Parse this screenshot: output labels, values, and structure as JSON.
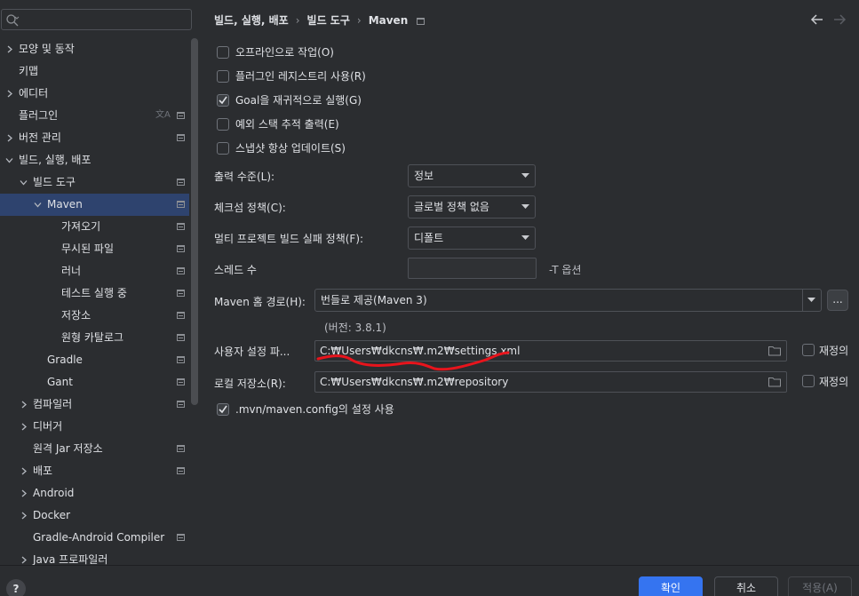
{
  "sidebar": {
    "search_placeholder": "",
    "items": [
      {
        "label": "모양 및 동작",
        "level": 0,
        "chevron": "right",
        "pin": false
      },
      {
        "label": "키맵",
        "level": 0,
        "chevron": "none",
        "pin": false
      },
      {
        "label": "에디터",
        "level": 0,
        "chevron": "right",
        "pin": false
      },
      {
        "label": "플러그인",
        "level": 0,
        "chevron": "none",
        "pin": true,
        "translate": true
      },
      {
        "label": "버전 관리",
        "level": 0,
        "chevron": "right",
        "pin": true
      },
      {
        "label": "빌드, 실행, 배포",
        "level": 0,
        "chevron": "down",
        "pin": false
      },
      {
        "label": "빌드 도구",
        "level": 1,
        "chevron": "down",
        "pin": true
      },
      {
        "label": "Maven",
        "level": 2,
        "chevron": "down",
        "pin": true,
        "selected": true
      },
      {
        "label": "가져오기",
        "level": 3,
        "chevron": "none",
        "pin": true
      },
      {
        "label": "무시된 파일",
        "level": 3,
        "chevron": "none",
        "pin": true
      },
      {
        "label": "러너",
        "level": 3,
        "chevron": "none",
        "pin": true
      },
      {
        "label": "테스트 실행 중",
        "level": 3,
        "chevron": "none",
        "pin": true
      },
      {
        "label": "저장소",
        "level": 3,
        "chevron": "none",
        "pin": true
      },
      {
        "label": "원형 카탈로그",
        "level": 3,
        "chevron": "none",
        "pin": true
      },
      {
        "label": "Gradle",
        "level": 2,
        "chevron": "none",
        "pin": true
      },
      {
        "label": "Gant",
        "level": 2,
        "chevron": "none",
        "pin": true
      },
      {
        "label": "컴파일러",
        "level": 1,
        "chevron": "right",
        "pin": true
      },
      {
        "label": "디버거",
        "level": 1,
        "chevron": "right",
        "pin": false
      },
      {
        "label": "원격 Jar 저장소",
        "level": 1,
        "chevron": "none",
        "pin": true
      },
      {
        "label": "배포",
        "level": 1,
        "chevron": "right",
        "pin": true
      },
      {
        "label": "Android",
        "level": 1,
        "chevron": "right",
        "pin": false
      },
      {
        "label": "Docker",
        "level": 1,
        "chevron": "right",
        "pin": false
      },
      {
        "label": "Gradle-Android Compiler",
        "level": 1,
        "chevron": "none",
        "pin": true
      },
      {
        "label": "Java 프로파일러",
        "level": 1,
        "chevron": "right",
        "pin": false
      }
    ]
  },
  "header": {
    "crumbs": [
      "빌드, 실행, 배포",
      "빌드 도구",
      "Maven"
    ]
  },
  "options": {
    "offline": {
      "label": "오프라인으로 작업(O)",
      "checked": false
    },
    "plugin_registry": {
      "label": "플러그인 레지스트리 사용(R)",
      "checked": false
    },
    "recursive_goals": {
      "label": "Goal을 재귀적으로 실행(G)",
      "checked": true
    },
    "stack_traces": {
      "label": "예외 스택 추적 출력(E)",
      "checked": false
    },
    "snapshots": {
      "label": "스냅샷 항상 업데이트(S)",
      "checked": false
    }
  },
  "output_level": {
    "label": "출력 수준(L):",
    "value": "정보"
  },
  "checksum_policy": {
    "label": "체크섬 정책(C):",
    "value": "글로벌 정책 없음"
  },
  "multiproject_fail": {
    "label": "멀티 프로젝트 빌드 실패 정책(F):",
    "value": "디폴트"
  },
  "threads": {
    "label": "스레드 수",
    "value": "",
    "suffix": "-T 옵션"
  },
  "maven_home": {
    "label": "Maven 홈 경로(H):",
    "value": "번들로 제공(Maven 3)",
    "browse": "...",
    "version": "(버전: 3.8.1)"
  },
  "user_settings": {
    "label": "사용자 설정 파...",
    "value": "C:₩Users₩dkcns₩.m2₩settings.xml",
    "override_label": "재정의",
    "override": false
  },
  "local_repo": {
    "label": "로컬 저장소(R):",
    "value": "C:₩Users₩dkcns₩.m2₩repository",
    "override_label": "재정의",
    "override": false
  },
  "mvn_config": {
    "label": ".mvn/maven.config의 설정 사용",
    "checked": true
  },
  "footer": {
    "help": "?",
    "ok": "확인",
    "cancel": "취소",
    "apply": "적용(A)"
  },
  "colors": {
    "accent": "#3574f0",
    "selection": "#2e436e",
    "annotation": "#e8141c"
  }
}
